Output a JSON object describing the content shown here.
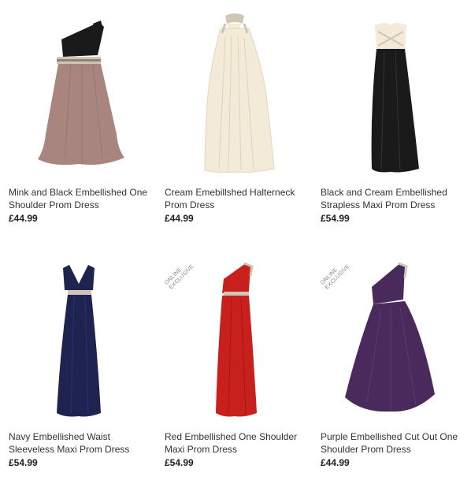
{
  "products": [
    {
      "name": "Mink and Black Embellished One Shoulder Prom Dress",
      "price": "£44.99",
      "badge": ""
    },
    {
      "name": "Cream Emebillshed Halterneck Prom Dress",
      "price": "£44.99",
      "badge": ""
    },
    {
      "name": "Black and Cream Embellished Strapless Maxi Prom Dress",
      "price": "£54.99",
      "badge": ""
    },
    {
      "name": "Navy Embellished Waist Sleeveless Maxi Prom Dress",
      "price": "£54.99",
      "badge": ""
    },
    {
      "name": "Red Embellished One Shoulder Maxi Prom Dress",
      "price": "£54.99",
      "badge": "ONLINE EXCLUSIVE"
    },
    {
      "name": "Purple Embellished Cut Out One Shoulder Prom Dress",
      "price": "£44.99",
      "badge": "ONLINE EXCLUSIVE"
    }
  ],
  "colors": {
    "mink": "#a9857f",
    "black": "#1a1a1a",
    "cream": "#f3ead8",
    "navy": "#1f2350",
    "red": "#c8201c",
    "purple": "#4a2a5c",
    "embellishment": "#cfc6b8"
  }
}
